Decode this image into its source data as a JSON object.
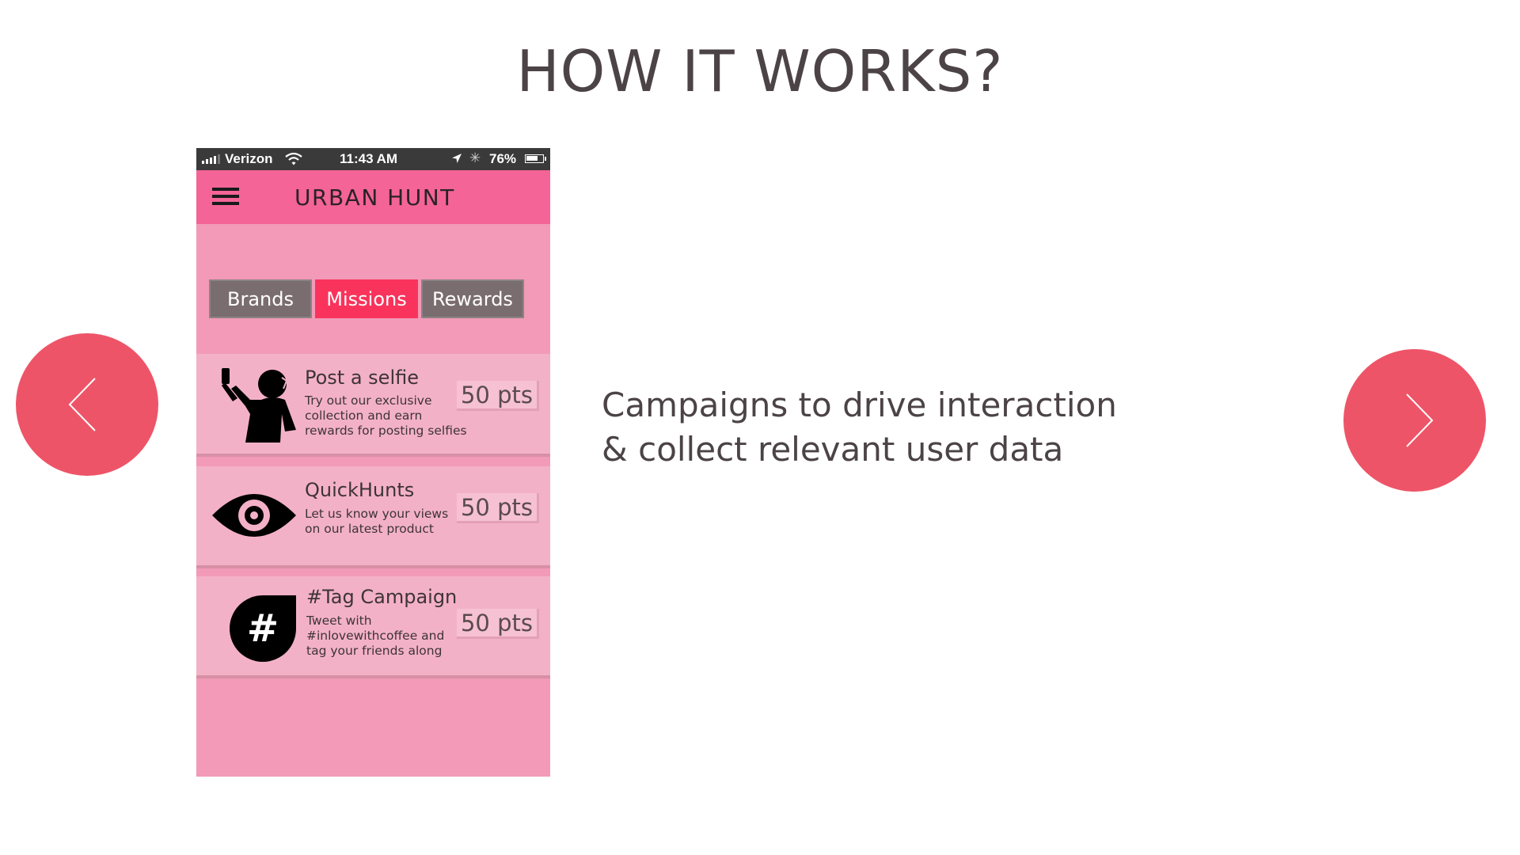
{
  "slide": {
    "title": "HOW IT WORKS?",
    "description_line1": "Campaigns to drive interaction",
    "description_line2": "& collect relevant user data",
    "prev_icon": "chevron-left-icon",
    "next_icon": "chevron-right-icon",
    "accent_color": "#ee5467"
  },
  "phone": {
    "status_bar": {
      "carrier": "Verizon",
      "time": "11:43 AM",
      "battery": "76%",
      "battery_level": 0.76
    },
    "app": {
      "title": "URBAN HUNT",
      "header_color": "#f46496",
      "background_color": "#f29ab7"
    },
    "tabs": [
      {
        "label": "Brands",
        "active": false
      },
      {
        "label": "Missions",
        "active": true
      },
      {
        "label": "Rewards",
        "active": false
      }
    ],
    "missions": [
      {
        "title": "Post a selfie",
        "desc_lines": [
          "Try out our exclusive",
          "collection and earn",
          "rewards for posting selfies"
        ],
        "points": "50 pts",
        "icon": "selfie-person-icon"
      },
      {
        "title": "QuickHunts",
        "desc_lines": [
          "Let us know your views",
          "on our latest product"
        ],
        "points": "50 pts",
        "icon": "eye-icon"
      },
      {
        "title": "#Tag Campaign",
        "desc_lines": [
          "Tweet with",
          "#inlovewithcoffee and",
          "tag your friends along"
        ],
        "points": "50 pts",
        "icon": "hashtag-icon"
      }
    ]
  }
}
